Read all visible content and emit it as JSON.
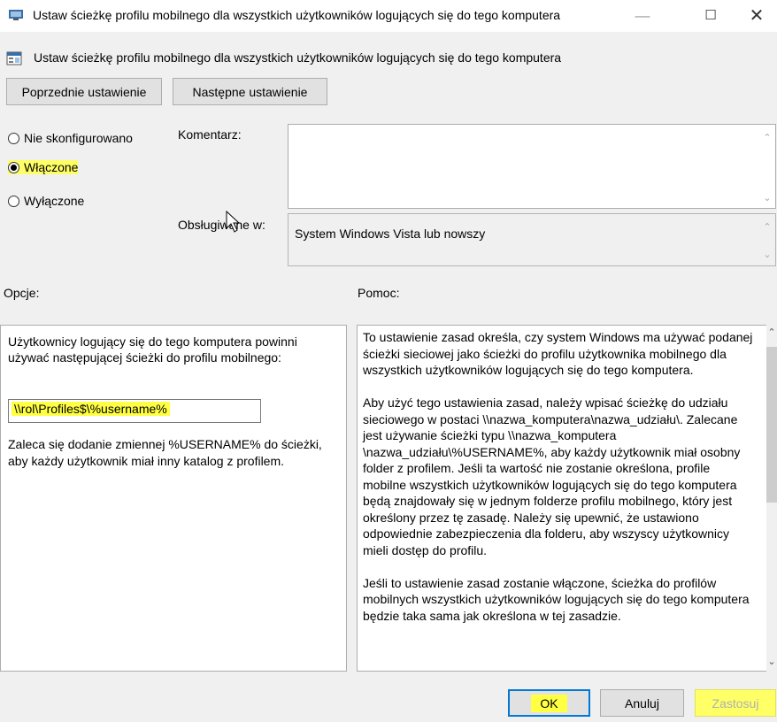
{
  "window": {
    "title": "Ustaw ścieżkę profilu mobilnego dla wszystkich użytkowników logujących się do tego komputera",
    "icons": [
      "policy-icon"
    ],
    "controls": {
      "minimize": "—",
      "maximize": "☐",
      "close": "✕"
    }
  },
  "header": {
    "title": "Ustaw ścieżkę profilu mobilnego dla wszystkich użytkowników logujących się do tego komputera",
    "prev_label": "Poprzednie ustawienie",
    "next_label": "Następne ustawienie"
  },
  "state": {
    "options": [
      {
        "label": "Nie skonfigurowano",
        "checked": false
      },
      {
        "label": "Włączone",
        "checked": true
      },
      {
        "label": "Wyłączone",
        "checked": false
      }
    ]
  },
  "comment": {
    "label": "Komentarz:",
    "value": ""
  },
  "supported": {
    "label": "Obsługiwane w:",
    "value": "System Windows Vista lub nowszy"
  },
  "options_section": {
    "label": "Opcje:",
    "description": "Użytkownicy logujący się do tego komputera powinni używać następującej ścieżki do profilu mobilnego:",
    "path_value": "\\\\rol\\Profiles$\\%username%",
    "note": "Zaleca się dodanie zmiennej %USERNAME% do ścieżki, aby każdy użytkownik miał inny katalog z profilem."
  },
  "help_section": {
    "label": "Pomoc:",
    "paragraphs": [
      "To ustawienie zasad określa, czy system Windows ma używać podanej ścieżki sieciowej jako ścieżki do profilu użytkownika mobilnego dla wszystkich użytkowników logujących się do tego komputera.",
      "Aby użyć tego ustawienia zasad, należy wpisać ścieżkę do udziału sieciowego w postaci \\\\nazwa_komputera\\nazwa_udziału\\. Zalecane jest używanie ścieżki typu \\\\nazwa_komputera \\nazwa_udziału\\%USERNAME%, aby każdy użytkownik miał osobny folder z profilem. Jeśli ta wartość nie zostanie określona, profile mobilne wszystkich użytkowników logujących się do tego komputera będą znajdowały się w jednym folderze profilu mobilnego, który jest określony przez tę zasadę. Należy się upewnić, że ustawiono odpowiednie zabezpieczenia dla folderu, aby wszyscy użytkownicy mieli dostęp do profilu.",
      "Jeśli to ustawienie zasad zostanie włączone, ścieżka do profilów mobilnych wszystkich użytkowników logujących się do tego komputera będzie taka sama jak określona w tej zasadzie."
    ]
  },
  "footer": {
    "ok": "OK",
    "cancel": "Anuluj",
    "apply": "Zastosuj"
  },
  "colors": {
    "highlight": "#ffff44",
    "focus": "#0078d7",
    "window_bg": "#f0f0f0"
  }
}
